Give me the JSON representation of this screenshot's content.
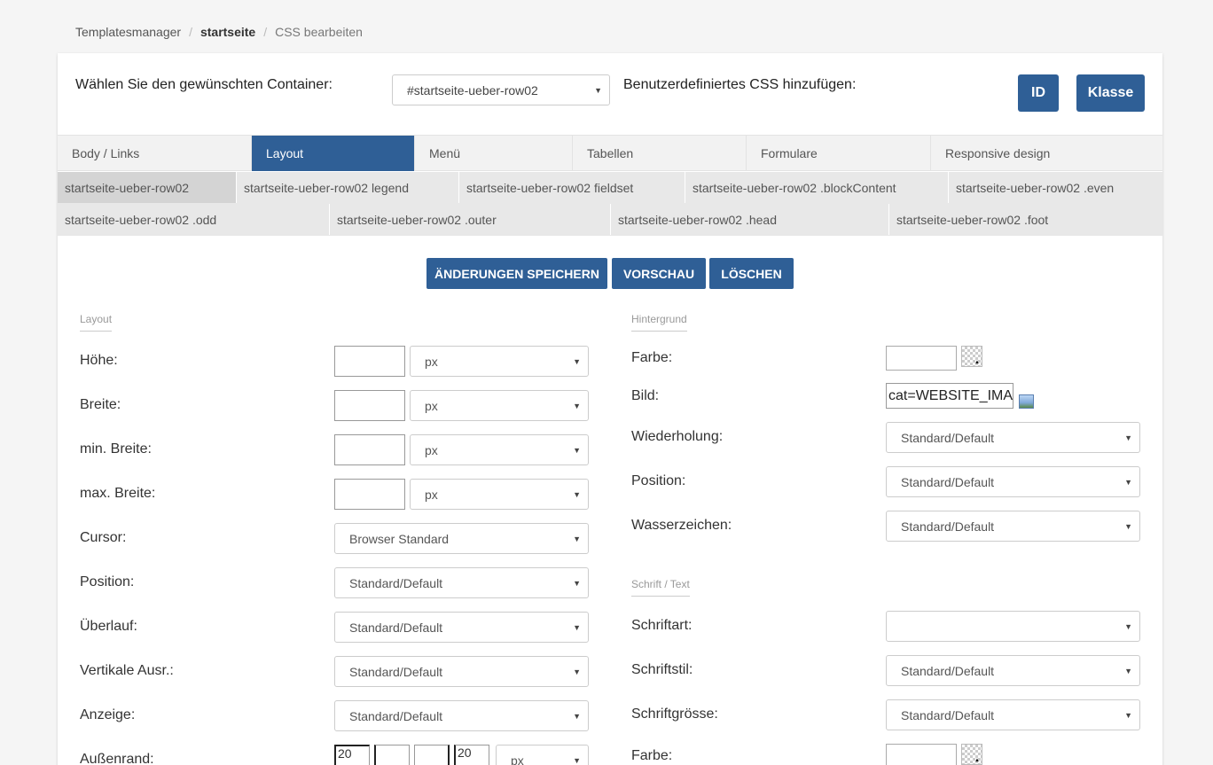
{
  "breadcrumb": {
    "item1": "Templatesmanager",
    "item2": "startseite",
    "item3": "CSS bearbeiten"
  },
  "top": {
    "container_label": "Wählen Sie den gewünschten Container:",
    "container_value": "#startseite-ueber-row02",
    "custom_css_label": "Benutzerdefiniertes CSS hinzufügen:",
    "id_button": "ID",
    "class_button": "Klasse"
  },
  "tabs": [
    "Body / Links",
    "Layout",
    "Menü",
    "Tabellen",
    "Formulare",
    "Responsive design"
  ],
  "subtabs_row1": [
    "startseite-ueber-row02",
    "startseite-ueber-row02 legend",
    "startseite-ueber-row02 fieldset",
    "startseite-ueber-row02 .blockContent",
    "startseite-ueber-row02 .even"
  ],
  "subtabs_row2": [
    "startseite-ueber-row02 .odd",
    "startseite-ueber-row02 .outer",
    "startseite-ueber-row02 .head",
    "startseite-ueber-row02 .foot"
  ],
  "actions": {
    "save": "ÄNDERUNGEN SPEICHERN",
    "preview": "VORSCHAU",
    "delete": "LÖSCHEN"
  },
  "layout": {
    "section_title": "Layout",
    "height_label": "Höhe:",
    "height_unit": "px",
    "width_label": "Breite:",
    "width_unit": "px",
    "minwidth_label": "min. Breite:",
    "minwidth_unit": "px",
    "maxwidth_label": "max. Breite:",
    "maxwidth_unit": "px",
    "cursor_label": "Cursor:",
    "cursor_value": "Browser Standard",
    "position_label": "Position:",
    "position_value": "Standard/Default",
    "overflow_label": "Überlauf:",
    "overflow_value": "Standard/Default",
    "valign_label": "Vertikale Ausr.:",
    "valign_value": "Standard/Default",
    "display_label": "Anzeige:",
    "display_value": "Standard/Default",
    "margin_label": "Außenrand:",
    "margin_top": "20",
    "margin_left": "20",
    "margin_unit": "px"
  },
  "background": {
    "section_title": "Hintergrund",
    "color_label": "Farbe:",
    "image_label": "Bild:",
    "image_value": "cat=WEBSITE_IMAG",
    "repeat_label": "Wiederholung:",
    "repeat_value": "Standard/Default",
    "position_label": "Position:",
    "position_value": "Standard/Default",
    "watermark_label": "Wasserzeichen:",
    "watermark_value": "Standard/Default"
  },
  "font": {
    "section_title": "Schrift / Text",
    "family_label": "Schriftart:",
    "family_value": "",
    "style_label": "Schriftstil:",
    "style_value": "Standard/Default",
    "size_label": "Schriftgrösse:",
    "size_value": "Standard/Default",
    "color_label": "Farbe:"
  }
}
